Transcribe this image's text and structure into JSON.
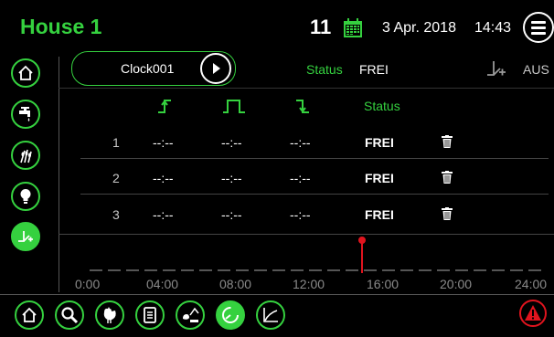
{
  "header": {
    "title": "House 1",
    "day": "11",
    "date": "3 Apr. 2018",
    "time": "14:43"
  },
  "clock": {
    "name": "Clock001",
    "status_label": "Status",
    "status_value": "FREI",
    "mode": "AUS"
  },
  "table": {
    "status_header": "Status",
    "rows": [
      {
        "num": "1",
        "on": "--:--",
        "pulse": "--:--",
        "off": "--:--",
        "status": "FREI"
      },
      {
        "num": "2",
        "on": "--:--",
        "pulse": "--:--",
        "off": "--:--",
        "status": "FREI"
      },
      {
        "num": "3",
        "on": "--:--",
        "pulse": "--:--",
        "off": "--:--",
        "status": "FREI"
      }
    ]
  },
  "timeline": {
    "ticks": [
      "0:00",
      "04:00",
      "08:00",
      "12:00",
      "16:00",
      "20:00",
      "24:00"
    ]
  },
  "colors": {
    "accent": "#35d13f",
    "alert": "#e0141e",
    "background": "#000000"
  },
  "sidebar": {
    "items": [
      "home-icon",
      "water-tap-icon",
      "feed-grain-icon",
      "light-bulb-icon",
      "clock-timer-icon"
    ]
  },
  "bottom_bar": {
    "items": [
      "home-icon",
      "search-icon",
      "hen-icon",
      "document-icon",
      "animals-scale-icon",
      "timer-icon",
      "chart-icon",
      "alarm-icon"
    ]
  }
}
